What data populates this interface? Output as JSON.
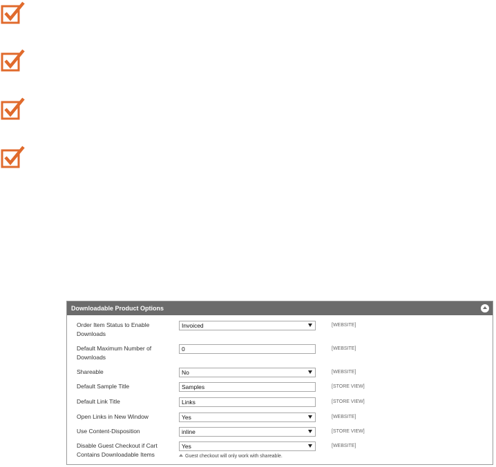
{
  "panel": {
    "title": "Downloadable Product Options",
    "rows": [
      {
        "label": "Order Item Status to Enable Downloads",
        "value": "Invoiced",
        "scope": "[WEBSITE]"
      },
      {
        "label": "Default Maximum Number of Downloads",
        "value": "0",
        "scope": "[WEBSITE]"
      },
      {
        "label": "Shareable",
        "value": "No",
        "scope": "[WEBSITE]"
      },
      {
        "label": "Default Sample Title",
        "value": "Samples",
        "scope": "[STORE VIEW]"
      },
      {
        "label": "Default Link Title",
        "value": "Links",
        "scope": "[STORE VIEW]"
      },
      {
        "label": "Open Links in New Window",
        "value": "Yes",
        "scope": "[WEBSITE]"
      },
      {
        "label": "Use Content-Disposition",
        "value": "inline",
        "scope": "[STORE VIEW]"
      },
      {
        "label": "Disable Guest Checkout if Cart Contains Downloadable Items",
        "value": "Yes",
        "scope": "[WEBSITE]"
      }
    ],
    "note": "Guest checkout will only work with shareable."
  },
  "icons": {
    "checkbox": "checkbox-checked-icon",
    "accent": "#e06a2c"
  }
}
